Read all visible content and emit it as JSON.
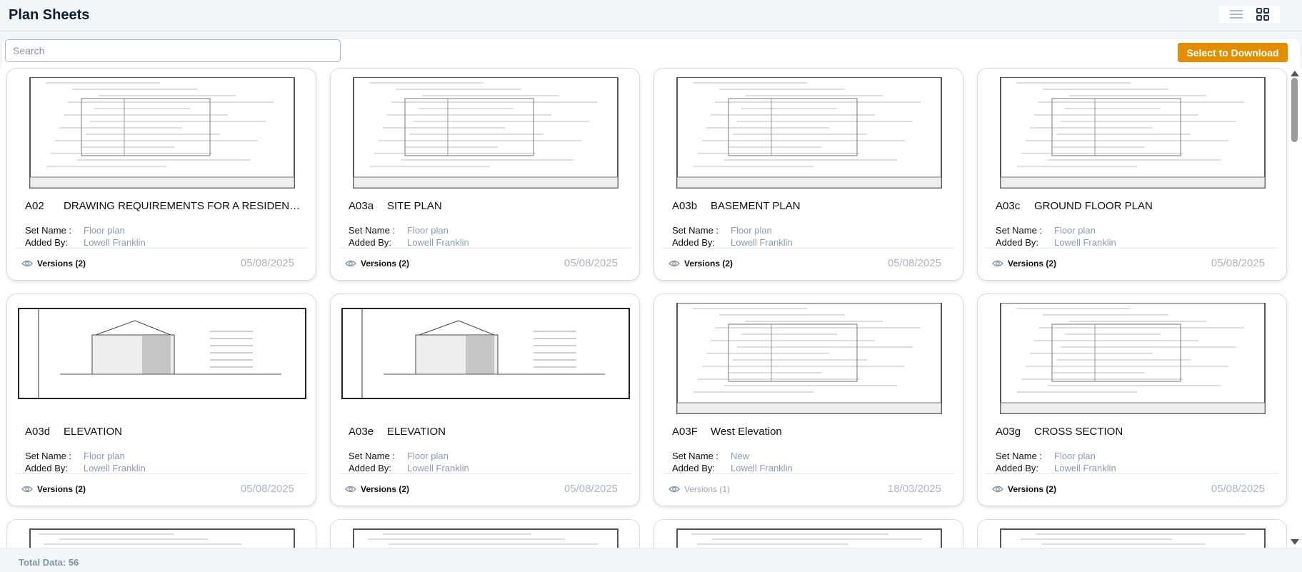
{
  "header": {
    "title": "Plan Sheets",
    "view_list_icon": "list-icon",
    "view_grid_icon": "grid-icon"
  },
  "toolbar": {
    "search_placeholder": "Search",
    "search_value": "",
    "download_label": "Select to Download"
  },
  "labels": {
    "set_name": "Set Name :",
    "added_by": "Added By:"
  },
  "sheets": [
    {
      "code": "A02",
      "name": "DRAWING REQUIREMENTS FOR A RESIDENTIAL ADD...",
      "set": "Floor plan",
      "added_by": "Lowell Franklin",
      "versions": "Versions (2)",
      "date": "05/08/2025"
    },
    {
      "code": "A03a",
      "name": "SITE PLAN",
      "set": "Floor plan",
      "added_by": "Lowell Franklin",
      "versions": "Versions (2)",
      "date": "05/08/2025"
    },
    {
      "code": "A03b",
      "name": "BASEMENT PLAN",
      "set": "Floor plan",
      "added_by": "Lowell Franklin",
      "versions": "Versions (2)",
      "date": "05/08/2025"
    },
    {
      "code": "A03c",
      "name": "GROUND FLOOR PLAN",
      "set": "Floor plan",
      "added_by": "Lowell Franklin",
      "versions": "Versions (2)",
      "date": "05/08/2025"
    },
    {
      "code": "A03d",
      "name": "ELEVATION",
      "set": "Floor plan",
      "added_by": "Lowell Franklin",
      "versions": "Versions (2)",
      "date": "05/08/2025"
    },
    {
      "code": "A03e",
      "name": "ELEVATION",
      "set": "Floor plan",
      "added_by": "Lowell Franklin",
      "versions": "Versions (2)",
      "date": "05/08/2025"
    },
    {
      "code": "A03F",
      "name": "West Elevation",
      "set": "New",
      "added_by": "Lowell Franklin",
      "versions": "Versions (1)",
      "date": "18/03/2025"
    },
    {
      "code": "A03g",
      "name": "CROSS SECTION",
      "set": "Floor plan",
      "added_by": "Lowell Franklin",
      "versions": "Versions (2)",
      "date": "05/08/2025"
    }
  ],
  "footer": {
    "total": "Total Data: 56"
  },
  "colors": {
    "accent": "#e38e00",
    "muted": "#8a9ab3",
    "title": "#0f1d33"
  }
}
